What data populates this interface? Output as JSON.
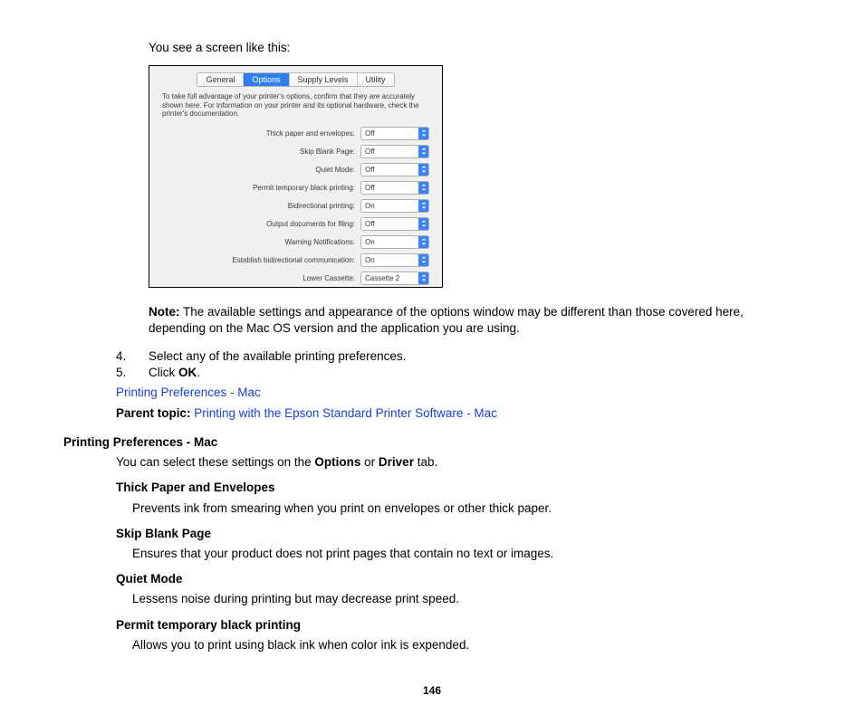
{
  "intro": "You see a screen like this:",
  "tabs": [
    "General",
    "Options",
    "Supply Levels",
    "Utility"
  ],
  "shotDesc": "To take full advantage of your printer's options, confirm that they are accurately shown here. For information on your printer and its optional hardware, check the printer's documentation.",
  "options": [
    {
      "label": "Thick paper and envelopes:",
      "value": "Off"
    },
    {
      "label": "Skip Blank Page:",
      "value": "Off"
    },
    {
      "label": "Quiet Mode:",
      "value": "Off"
    },
    {
      "label": "Permit temporary black printing:",
      "value": "Off"
    },
    {
      "label": "Bidirectional printing:",
      "value": "On"
    },
    {
      "label": "Output documents for filing:",
      "value": "Off"
    },
    {
      "label": "Warning Notifications:",
      "value": "On"
    },
    {
      "label": "Establish bidirectional communication:",
      "value": "On"
    },
    {
      "label": "Lower Cassette:",
      "value": "Cassette 2"
    }
  ],
  "note": {
    "label": "Note:",
    "text": " The available settings and appearance of the options window may be different than those covered here, depending on the Mac OS version and the application you are using."
  },
  "steps": [
    {
      "n": "4.",
      "t": "Select any of the available printing preferences."
    },
    {
      "n": "5.",
      "pre": "Click ",
      "bold": "OK",
      "post": "."
    }
  ],
  "link1": "Printing Preferences - Mac",
  "parent": {
    "label": "Parent topic:",
    "link": "Printing with the Epson Standard Printer Software - Mac"
  },
  "h2": "Printing Preferences - Mac",
  "lead": {
    "a": "You can select these settings on the ",
    "b": "Options",
    "c": " or ",
    "d": "Driver",
    "e": " tab."
  },
  "defs": [
    {
      "term": "Thick Paper and Envelopes",
      "desc": "Prevents ink from smearing when you print on envelopes or other thick paper."
    },
    {
      "term": "Skip Blank Page",
      "desc": "Ensures that your product does not print pages that contain no text or images."
    },
    {
      "term": "Quiet Mode",
      "desc": "Lessens noise during printing but may decrease print speed."
    },
    {
      "term": "Permit temporary black printing",
      "desc": "Allows you to print using black ink when color ink is expended."
    }
  ],
  "pageNumber": "146"
}
